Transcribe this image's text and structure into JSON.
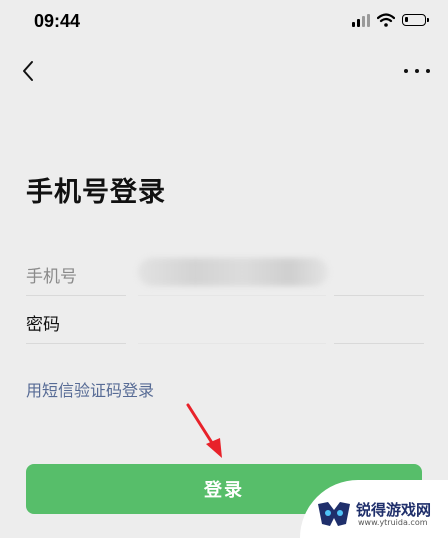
{
  "status_bar": {
    "time": "09:44",
    "icons": [
      "signal-icon",
      "wifi-icon",
      "battery-icon"
    ],
    "battery_level": 0.2
  },
  "nav": {
    "back_icon": "chevron-left-icon",
    "more_icon": "more-horizontal-icon"
  },
  "page": {
    "title": "手机号登录"
  },
  "form": {
    "phone_label": "手机号",
    "phone_value": "",
    "password_label": "密码",
    "password_value": ""
  },
  "links": {
    "sms_login": "用短信验证码登录"
  },
  "actions": {
    "login_label": "登录"
  },
  "watermark": {
    "name": "锐得游戏网",
    "url": "www.ytruida.com"
  },
  "colors": {
    "background": "#ededed",
    "accent_green": "#57be6a",
    "link_blue": "#576b95",
    "arrow_red": "#e8222a"
  }
}
